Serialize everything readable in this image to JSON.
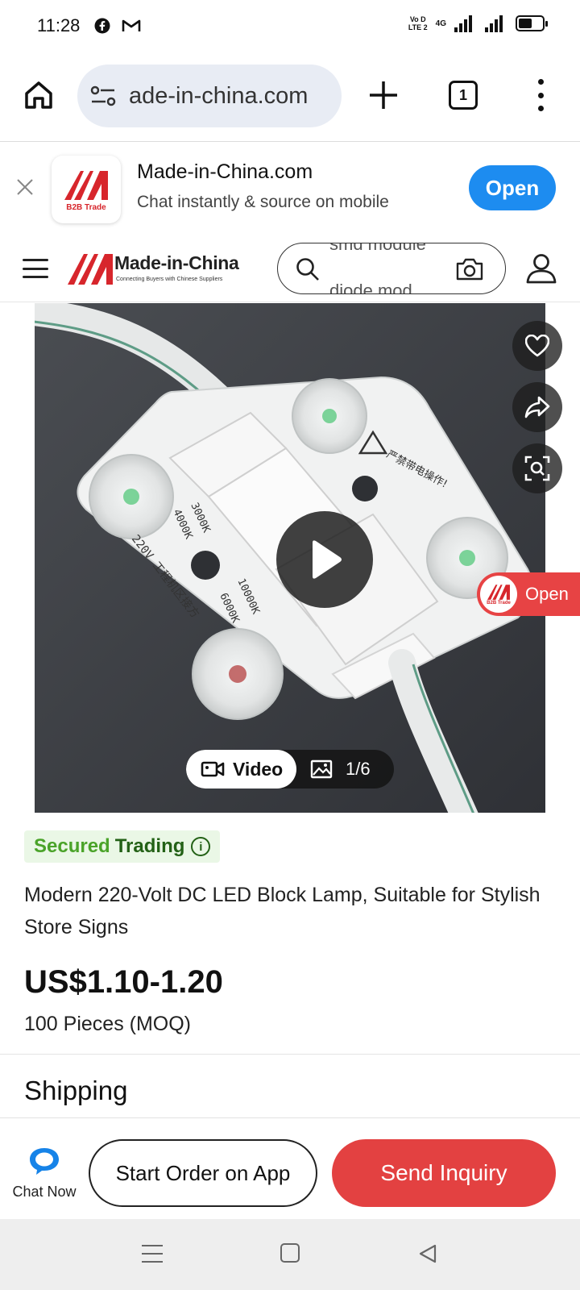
{
  "status_bar": {
    "time": "11:28",
    "left_icons": [
      "facebook-icon",
      "gmail-icon"
    ],
    "volte_line1": "Vo D",
    "volte_line2": "LTE 2",
    "network": "4G",
    "battery_level": 0.6
  },
  "browser": {
    "url": "ade-in-china.com",
    "tab_count": "1"
  },
  "app_banner": {
    "logo_text": "B2B Trade",
    "title": "Made-in-China.com",
    "subtitle": "Chat instantly & source on mobile",
    "open_label": "Open",
    "accent": "#1d8cf0"
  },
  "site_header": {
    "logo_text": "Made-in-China",
    "logo_tagline": "Connecting Buyers with Chinese Suppliers",
    "search_rotating_1": "smd module",
    "search_rotating_2": "diode mod",
    "brand_color": "#d7262c"
  },
  "gallery": {
    "video_label": "Video",
    "photo_counter": "1/6",
    "float_open_label": "Open",
    "float_logo_text": "B2B Trade",
    "product_print": {
      "warn": "严禁带电操作!",
      "mark1": "3000K",
      "mark2": "4000K",
      "mark3": "10000K",
      "mark4": "6000K",
      "voltage": "220V 工程机区接方"
    }
  },
  "product": {
    "secured_part1": "Secured",
    "secured_part2": "Trading",
    "title": "Modern 220-Volt DC LED Block Lamp, Suitable for Stylish Store Signs",
    "price": "US$1.10-1.20",
    "moq": "100 Pieces (MOQ)",
    "shipping_heading": "Shipping"
  },
  "actions": {
    "chat_label": "Chat Now",
    "start_order_label": "Start Order on App",
    "send_inquiry_label": "Send Inquiry",
    "inquiry_color": "#e34141"
  }
}
